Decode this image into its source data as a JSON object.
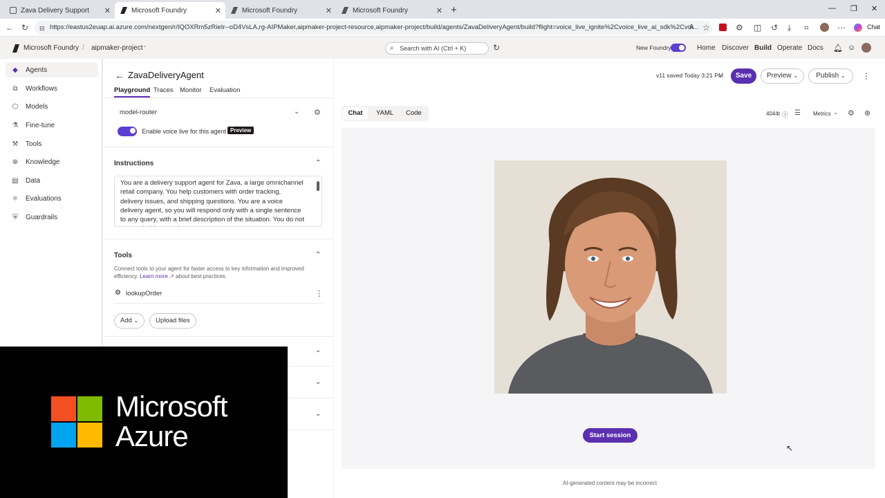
{
  "browser": {
    "tabs": [
      {
        "title": "Zava Delivery Support",
        "active": false
      },
      {
        "title": "Microsoft Foundry",
        "active": true
      },
      {
        "title": "Microsoft Foundry",
        "active": false
      },
      {
        "title": "Microsoft Foundry",
        "active": false
      }
    ],
    "url": "https://eastus2euap.ai.azure.com/nextgen/r/IQOXRm5zRieIr--oD4VsLA,rg-AIPMaker,aipmaker-project-resource,aipmaker-project/build/agents/ZavaDeliveryAgent/build?flight=voice_live_ignite%2Cvoice_live_ai_sdk%2Cvoi...",
    "chat_label": "Chat"
  },
  "header": {
    "brand": "Microsoft Foundry",
    "project": "aipmaker-project",
    "search_placeholder": "Search with AI (Ctrl + K)",
    "new_foundry_label": "New Foundry",
    "nav": [
      "Home",
      "Discover",
      "Build",
      "Operate",
      "Docs"
    ]
  },
  "sidebar": {
    "items": [
      {
        "label": "Agents",
        "icon": "agents-icon",
        "active": true
      },
      {
        "label": "Workflows",
        "icon": "workflows-icon"
      },
      {
        "label": "Models",
        "icon": "models-icon"
      },
      {
        "label": "Fine-tune",
        "icon": "fine-tune-icon"
      },
      {
        "label": "Tools",
        "icon": "tools-icon"
      },
      {
        "label": "Knowledge",
        "icon": "knowledge-icon"
      },
      {
        "label": "Data",
        "icon": "data-icon"
      },
      {
        "label": "Evaluations",
        "icon": "evaluations-icon"
      },
      {
        "label": "Guardrails",
        "icon": "guardrails-icon"
      }
    ]
  },
  "agent": {
    "name": "ZavaDeliveryAgent",
    "tabs": [
      "Playground",
      "Traces",
      "Monitor",
      "Evaluation"
    ],
    "version_status": "v11 saved Today 3:21 PM",
    "save_label": "Save",
    "preview_label": "Preview",
    "publish_label": "Publish"
  },
  "config": {
    "model": "model-router",
    "voice_toggle_label": "Enable voice live for this agent",
    "preview_badge": "Preview",
    "instructions_title": "Instructions",
    "instructions_text": "You are a delivery support agent for Zava, a large omnichannel retail company. You help customers with order tracking, delivery issues, and shipping questions. You are a voice delivery agent, so you will respond only with a single sentence to any query, with a brief description of the situation. You do not respond with more than one",
    "tools_title": "Tools",
    "tools_desc_prefix": "Connect tools to your agent for faster access to key information and improved efficiency.",
    "tools_learn_more": "Learn more",
    "tools_desc_suffix": "about best practices.",
    "tool_items": [
      "lookupOrder"
    ],
    "add_label": "Add",
    "upload_label": "Upload files"
  },
  "chat": {
    "tabs": [
      "Chat",
      "YAML",
      "Code"
    ],
    "token_count": "4044t",
    "metrics_label": "Metrics",
    "start_session_label": "Start session",
    "disclaimer": "AI-generated content may be incorrect"
  },
  "overlay": {
    "logo_line1": "Microsoft",
    "logo_line2": "Azure",
    "logo_colors": [
      "#f25022",
      "#7fba00",
      "#00a4ef",
      "#ffb900"
    ]
  },
  "colors": {
    "accent": "#5b2fb0",
    "toggle": "#5b3fd0"
  }
}
